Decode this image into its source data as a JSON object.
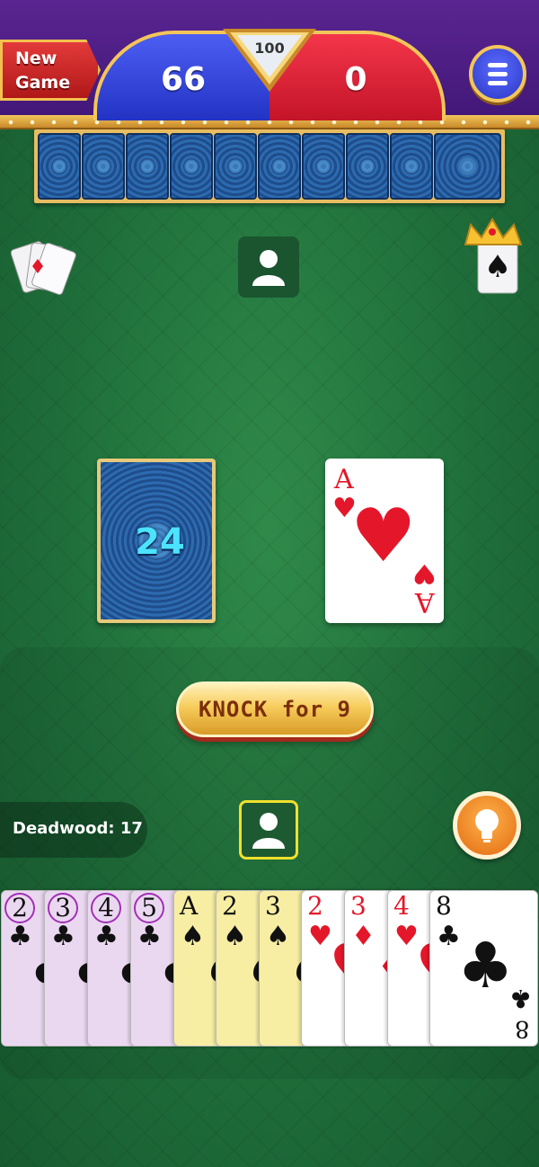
{
  "header": {
    "new_game_line1": "New",
    "new_game_line2": "Game",
    "target_score": "100",
    "player_score": "66",
    "opponent_score": "0"
  },
  "opponent": {
    "card_count": 10
  },
  "table": {
    "deck_count": "24",
    "discard_rank": "A",
    "discard_suit": "hearts"
  },
  "actions": {
    "knock_label": "KNOCK for 9"
  },
  "player": {
    "deadwood_label": "Deadwood:",
    "deadwood_value": "17",
    "hand": [
      {
        "rank": "2",
        "suit": "♣",
        "color": "black",
        "meld": "purple"
      },
      {
        "rank": "3",
        "suit": "♣",
        "color": "black",
        "meld": "purple"
      },
      {
        "rank": "4",
        "suit": "♣",
        "color": "black",
        "meld": "purple"
      },
      {
        "rank": "5",
        "suit": "♣",
        "color": "black",
        "meld": "purple"
      },
      {
        "rank": "A",
        "suit": "♠",
        "color": "black",
        "meld": "yellow"
      },
      {
        "rank": "2",
        "suit": "♠",
        "color": "black",
        "meld": "yellow"
      },
      {
        "rank": "3",
        "suit": "♠",
        "color": "black",
        "meld": "yellow"
      },
      {
        "rank": "2",
        "suit": "♥",
        "color": "red",
        "meld": "none"
      },
      {
        "rank": "3",
        "suit": "♦",
        "color": "red",
        "meld": "none"
      },
      {
        "rank": "4",
        "suit": "♥",
        "color": "red",
        "meld": "none"
      },
      {
        "rank": "8",
        "suit": "♣",
        "color": "black",
        "meld": "none"
      }
    ]
  },
  "colors": {
    "felt": "#1f6e3a",
    "top_bar": "#4a1b82",
    "player_score_bg": "#2f3fd6",
    "opponent_score_bg": "#e0203a",
    "gold": "#f3c65a"
  }
}
